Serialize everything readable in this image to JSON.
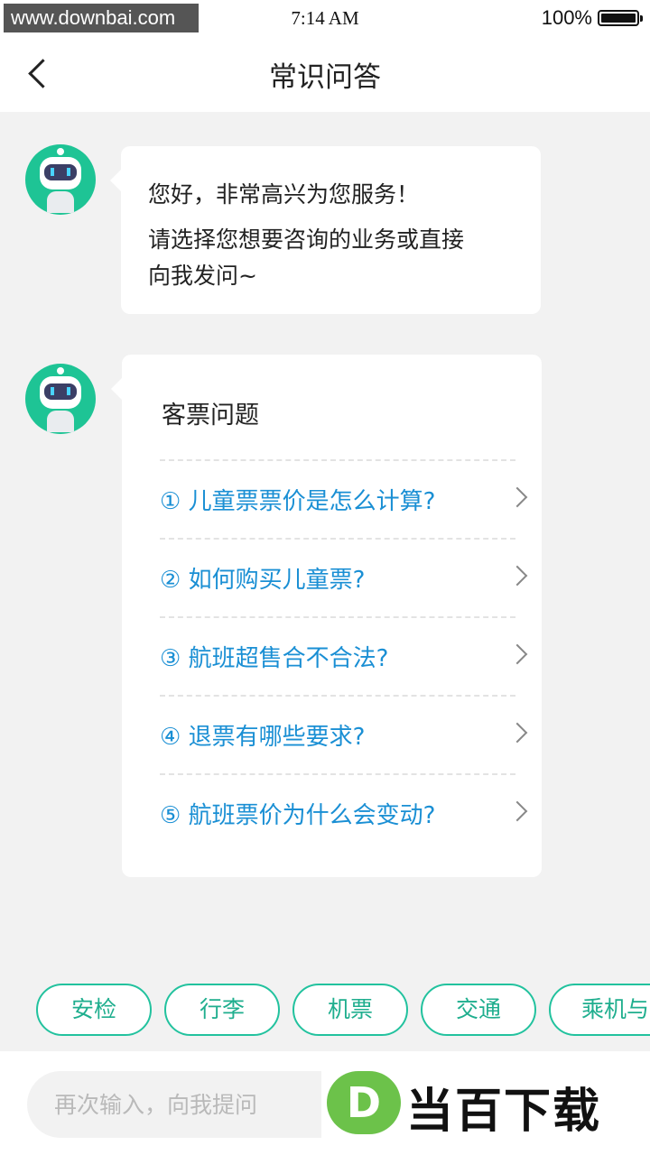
{
  "status_bar": {
    "watermark": "www.downbai.com",
    "time": "7:14 AM",
    "battery": "100%"
  },
  "header": {
    "title": "常识问答"
  },
  "greeting": {
    "line1": "您好，非常高兴为您服务！",
    "line2": "请选择您想要咨询的业务或直接",
    "line3": "向我发问~"
  },
  "faq": {
    "title": "客票问题",
    "items": [
      "① 儿童票票价是怎么计算?",
      "② 如何购买儿童票?",
      "③ 航班超售合不合法?",
      "④  退票有哪些要求?",
      "⑤  航班票价为什么会变动?"
    ]
  },
  "tags": [
    "安检",
    "行李",
    "机票",
    "交通",
    "乘机与"
  ],
  "input": {
    "placeholder": "再次输入，向我提问"
  },
  "watermark_bottom": {
    "logo_letter": "D",
    "text": "当百下载"
  },
  "colors": {
    "accent_green": "#22c29e",
    "link_blue": "#1a8fd4",
    "avatar_green": "#1ec495"
  }
}
